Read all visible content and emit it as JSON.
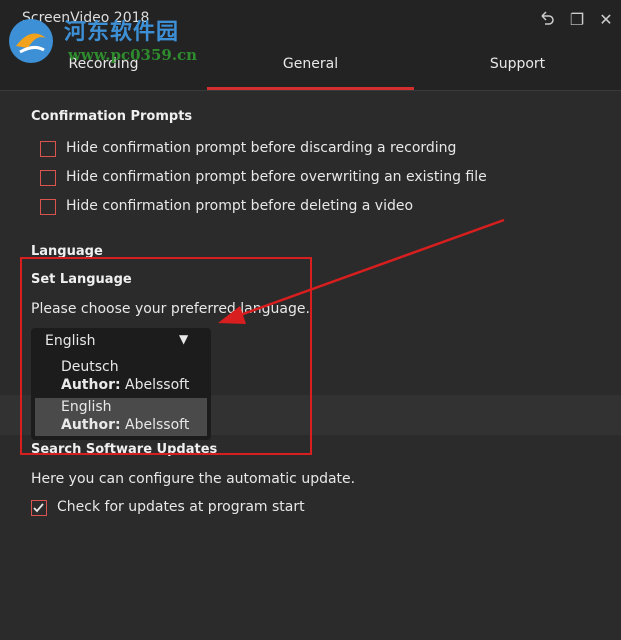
{
  "app": {
    "title": "ScreenVideo 2018",
    "watermark_line1": "河东软件园",
    "watermark_line2": "www.pc0359.cn"
  },
  "window_controls": {
    "back_icon": "undo-arrow-icon",
    "restore_symbol": "❐",
    "close_symbol": "✕"
  },
  "tabs": [
    {
      "label": "Recording",
      "active": false
    },
    {
      "label": "General",
      "active": true
    },
    {
      "label": "Support",
      "active": false
    }
  ],
  "confirmation": {
    "title": "Confirmation Prompts",
    "options": [
      {
        "label": "Hide confirmation prompt before discarding a recording",
        "checked": false
      },
      {
        "label": "Hide confirmation prompt before overwriting an existing file",
        "checked": false
      },
      {
        "label": "Hide confirmation prompt before deleting a video",
        "checked": false
      }
    ]
  },
  "language": {
    "title": "Language",
    "set_title": "Set Language",
    "prompt": "Please choose your preferred language.",
    "selected": "English",
    "options": [
      {
        "name": "Deutsch",
        "author_label": "Author:",
        "author": "Abelssoft"
      },
      {
        "name": "English",
        "author_label": "Author:",
        "author": "Abelssoft",
        "highlighted": true
      }
    ]
  },
  "updates": {
    "title": "Search Software Updates",
    "description": "Here you can configure the automatic update.",
    "check_label": "Check for updates at program start",
    "check_checked": true
  },
  "colors": {
    "background": "#2b2b2b",
    "accent": "#d32f2f",
    "annotation_red": "#d81e1e"
  }
}
